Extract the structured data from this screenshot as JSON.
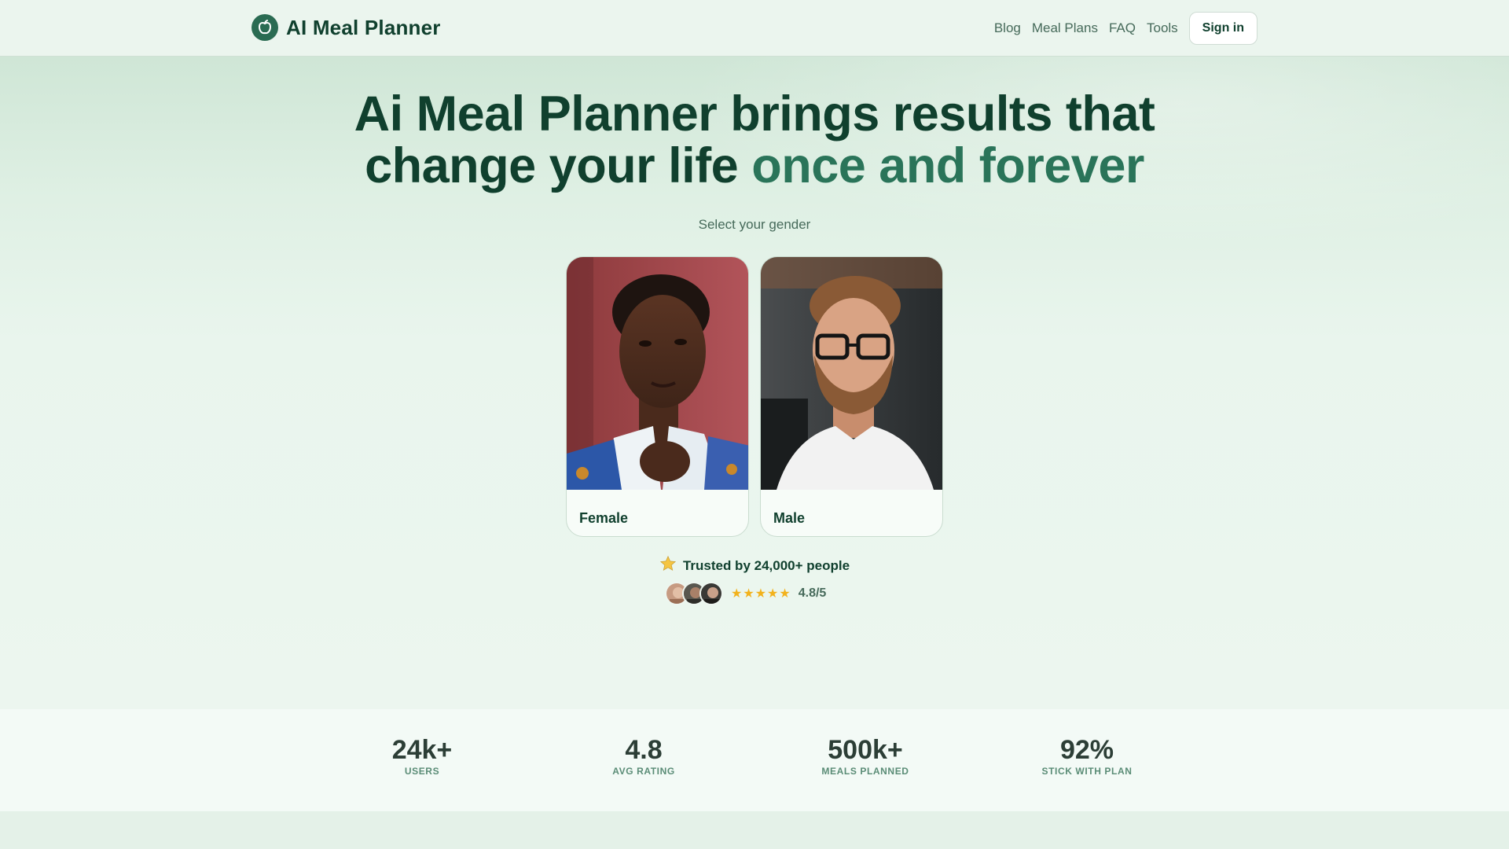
{
  "header": {
    "brand": "AI Meal Planner",
    "nav": [
      "Blog",
      "Meal Plans",
      "FAQ",
      "Tools"
    ],
    "signin_label": "Sign in"
  },
  "hero": {
    "title_line1": "Ai Meal Planner brings results that",
    "title_line2_plain": "change your life",
    "title_line2_accent": "once and forever",
    "subtitle": "Select your gender"
  },
  "gender_options": [
    {
      "label": "Female"
    },
    {
      "label": "Male"
    }
  ],
  "trust": {
    "text": "Trusted by 24,000+ people",
    "rating": "4.8/5",
    "stars": 5
  },
  "stats": [
    {
      "value": "24k+",
      "label": "USERS"
    },
    {
      "value": "4.8",
      "label": "AVG RATING"
    },
    {
      "value": "500k+",
      "label": "MEALS PLANNED"
    },
    {
      "value": "92%",
      "label": "STICK WITH PLAN"
    }
  ],
  "colors": {
    "brand": "#2a6b52",
    "heading": "#10402e",
    "accent": "#2a7459",
    "star": "#f2b21c"
  }
}
